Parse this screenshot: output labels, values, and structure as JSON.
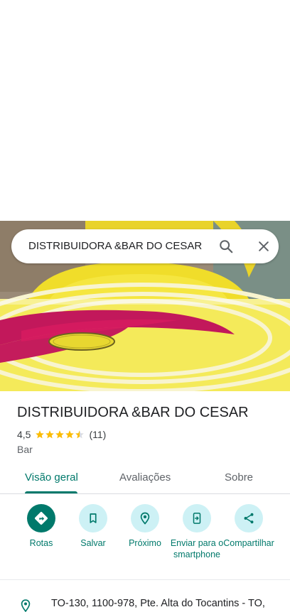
{
  "search": {
    "query": "DISTRIBUIDORA &BAR DO CESAR"
  },
  "place": {
    "name": "DISTRIBUIDORA &BAR DO CESAR",
    "rating": "4,5",
    "stars": 4.5,
    "review_count": "(11)",
    "category": "Bar"
  },
  "tabs": [
    {
      "label": "Visão geral",
      "active": true
    },
    {
      "label": "Avaliações",
      "active": false
    },
    {
      "label": "Sobre",
      "active": false
    }
  ],
  "actions": [
    {
      "label": "Rotas",
      "icon": "directions-icon"
    },
    {
      "label": "Salvar",
      "icon": "bookmark-icon"
    },
    {
      "label": "Próximo",
      "icon": "nearby-icon"
    },
    {
      "label": "Enviar para o smartphone",
      "icon": "send-to-phone-icon"
    },
    {
      "label": "Compartilhar",
      "icon": "share-icon"
    }
  ],
  "address": {
    "text": "TO-130, 1100-978, Pte. Alta do Tocantins - TO,"
  },
  "colors": {
    "accent": "#00796b",
    "action_bg": "#cdf1f5",
    "star": "#fbbc04"
  }
}
